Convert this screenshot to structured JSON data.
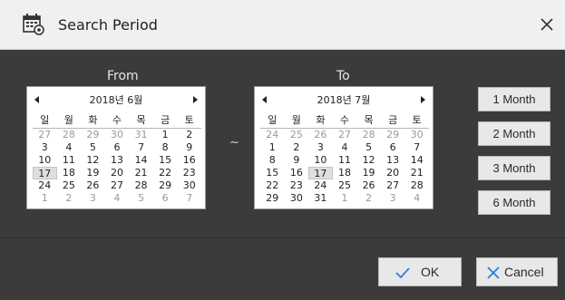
{
  "window": {
    "title": "Search Period",
    "icons": {
      "title": "calendar-gear-icon",
      "close": "close-icon"
    }
  },
  "labels": {
    "from": "From",
    "to": "To",
    "separator": "~"
  },
  "calendars": {
    "from": {
      "month_label": "2018년 6월",
      "weekdays": [
        "일",
        "월",
        "화",
        "수",
        "목",
        "금",
        "토"
      ],
      "weeks": [
        [
          "27",
          "28",
          "29",
          "30",
          "31",
          "1",
          "2"
        ],
        [
          "3",
          "4",
          "5",
          "6",
          "7",
          "8",
          "9"
        ],
        [
          "10",
          "11",
          "12",
          "13",
          "14",
          "15",
          "16"
        ],
        [
          "17",
          "18",
          "19",
          "20",
          "21",
          "22",
          "23"
        ],
        [
          "24",
          "25",
          "26",
          "27",
          "28",
          "29",
          "30"
        ],
        [
          "1",
          "2",
          "3",
          "4",
          "5",
          "6",
          "7"
        ]
      ],
      "selected_day": "17"
    },
    "to": {
      "month_label": "2018년 7월",
      "weekdays": [
        "일",
        "월",
        "화",
        "수",
        "목",
        "금",
        "토"
      ],
      "weeks": [
        [
          "24",
          "25",
          "26",
          "27",
          "28",
          "29",
          "30"
        ],
        [
          "1",
          "2",
          "3",
          "4",
          "5",
          "6",
          "7"
        ],
        [
          "8",
          "9",
          "10",
          "11",
          "12",
          "13",
          "14"
        ],
        [
          "15",
          "16",
          "17",
          "18",
          "19",
          "20",
          "21"
        ],
        [
          "22",
          "23",
          "24",
          "25",
          "26",
          "27",
          "28"
        ],
        [
          "29",
          "30",
          "31",
          "1",
          "2",
          "3",
          "4"
        ]
      ],
      "selected_day": "17"
    }
  },
  "quick_buttons": {
    "one_month": "1 Month",
    "two_month": "2 Month",
    "three_month": "3 Month",
    "six_month": "6 Month"
  },
  "footer": {
    "ok": "OK",
    "cancel": "Cancel",
    "icons": {
      "ok": "checkmark-icon",
      "cancel": "x-icon"
    }
  },
  "colors": {
    "title_bar": "#f0f0f0",
    "body": "#3b3b3b",
    "accent_blue": "#2f7fd6",
    "button_bg": "#e8e8e8",
    "dim_day": "#9a9a9a"
  }
}
